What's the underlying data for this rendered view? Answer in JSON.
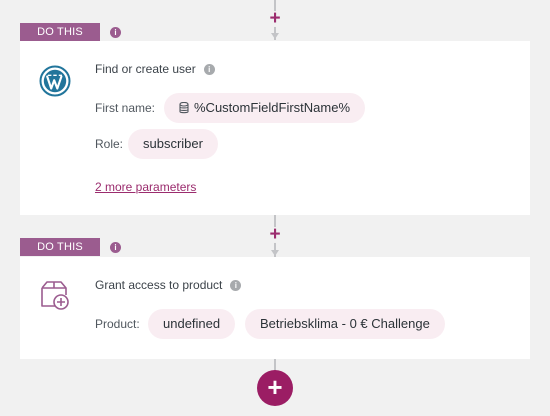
{
  "flow": {
    "add_symbol": "+",
    "info_symbol": "i"
  },
  "steps": [
    {
      "badge": "DO THIS",
      "icon": "wordpress-icon",
      "title": "Find or create user",
      "params": [
        {
          "label": "First name:",
          "value": "%CustomFieldFirstName%",
          "value_icon": "database-icon"
        },
        {
          "label": "Role:",
          "value": "subscriber"
        }
      ],
      "more_link": "2 more parameters"
    },
    {
      "badge": "DO THIS",
      "icon": "product-box-add-icon",
      "title": "Grant access to product",
      "params": [
        {
          "label": "Product:",
          "values": [
            "undefined",
            "Betriebsklima - 0 € Challenge"
          ]
        }
      ]
    }
  ],
  "colors": {
    "accent": "#9b1d64",
    "badge": "#9b5c8f",
    "pill_bg": "#f9edf2",
    "wordpress": "#21759b"
  }
}
